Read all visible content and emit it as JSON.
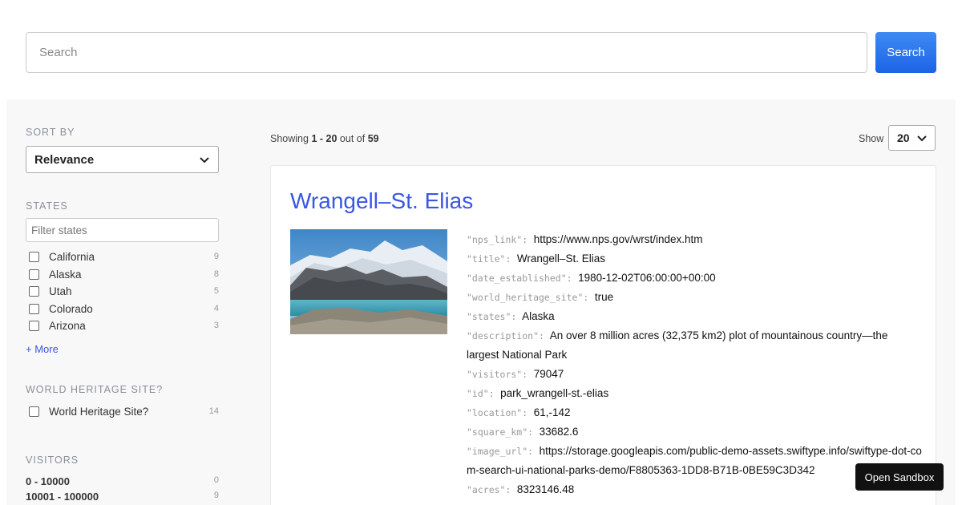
{
  "search": {
    "placeholder": "Search",
    "button_label": "Search"
  },
  "sort": {
    "title": "Sort by",
    "selected": "Relevance"
  },
  "states_facet": {
    "title": "States",
    "filter_placeholder": "Filter states",
    "options": [
      {
        "label": "California",
        "count": "9"
      },
      {
        "label": "Alaska",
        "count": "8"
      },
      {
        "label": "Utah",
        "count": "5"
      },
      {
        "label": "Colorado",
        "count": "4"
      },
      {
        "label": "Arizona",
        "count": "3"
      }
    ],
    "more_label": "+ More"
  },
  "whs_facet": {
    "title": "World Heritage Site?",
    "options": [
      {
        "label": "World Heritage Site?",
        "count": "14"
      }
    ]
  },
  "visitors_facet": {
    "title": "Visitors",
    "ranges": [
      {
        "label": "0 - 10000",
        "count": "0"
      },
      {
        "label": "10001 - 100000",
        "count": "9"
      }
    ]
  },
  "paging": {
    "prefix": "Showing",
    "start": "1",
    "separator": "-",
    "end": "20",
    "out_of": "out of",
    "total": "59"
  },
  "page_size": {
    "label": "Show",
    "selected": "20"
  },
  "result": {
    "title": "Wrangell–St. Elias",
    "fields": [
      {
        "key": "\"nps_link\":",
        "value": "https://www.nps.gov/wrst/index.htm"
      },
      {
        "key": "\"title\":",
        "value": "Wrangell–St. Elias"
      },
      {
        "key": "\"date_established\":",
        "value": "1980-12-02T06:00:00+00:00"
      },
      {
        "key": "\"world_heritage_site\":",
        "value": "true"
      },
      {
        "key": "\"states\":",
        "value": "Alaska"
      },
      {
        "key": "\"description\":",
        "value": "An over 8 million acres (32,375 km2) plot of mountainous country—the largest National Park"
      },
      {
        "key": "\"visitors\":",
        "value": "79047"
      },
      {
        "key": "\"id\":",
        "value": "park_wrangell-st.-elias"
      },
      {
        "key": "\"location\":",
        "value": "61,-142"
      },
      {
        "key": "\"square_km\":",
        "value": "33682.6"
      },
      {
        "key": "\"image_url\":",
        "value": "https://storage.googleapis.com/public-demo-assets.swiftype.info/swiftype-dot-com-search-ui-national-parks-demo/F8805363-1DD8-B71B-0BE59C3D342"
      },
      {
        "key": "\"acres\":",
        "value": "8323146.48"
      }
    ]
  },
  "sandbox": {
    "label": "Open Sandbox"
  }
}
